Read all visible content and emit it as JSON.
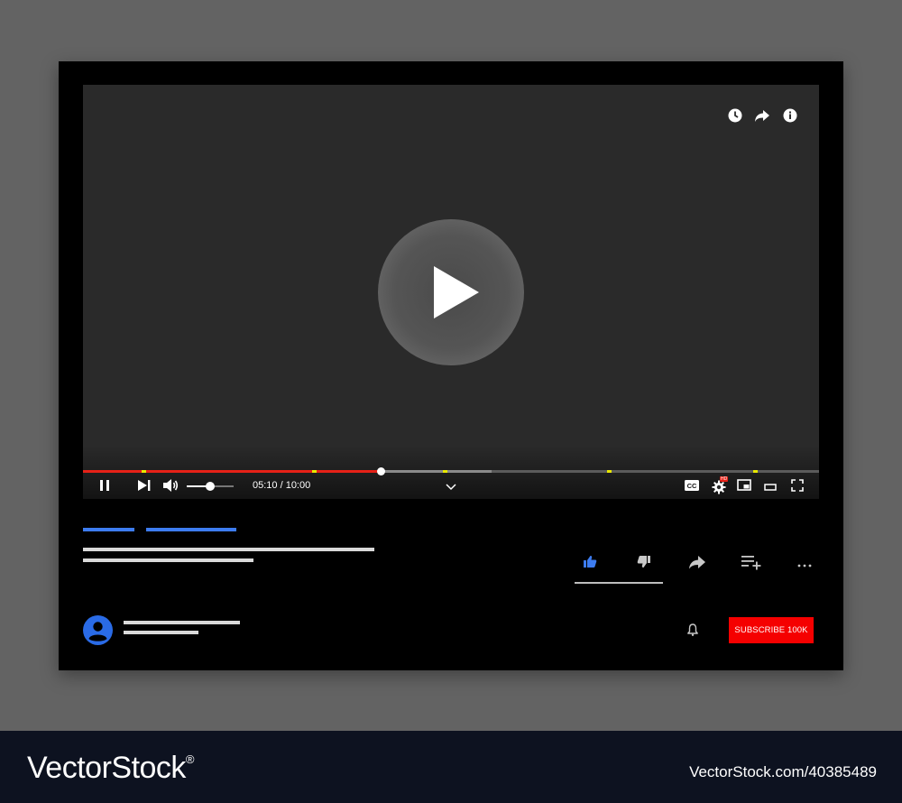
{
  "player": {
    "time_display": "05:10 / 10:00",
    "progress_played": 0.405,
    "progress_buffered": 0.555,
    "volume_level": 0.5,
    "chapter_markers": [
      0.082,
      0.314,
      0.491,
      0.714,
      0.913
    ],
    "settings_badge": "HD",
    "top_icons": [
      "watch-later-icon",
      "share-icon",
      "info-icon"
    ]
  },
  "actions": [
    "like-icon",
    "dislike-icon",
    "share-icon",
    "add-to-playlist-icon",
    "more-icon"
  ],
  "channel": {
    "subscribe_label": "SUBSCRIBE 100K"
  },
  "footer": {
    "brand": "VectorStock",
    "registered_mark": "®",
    "stock_id": "VectorStock.com/40385489"
  },
  "colors": {
    "played": "#e62117",
    "accent_blue": "#3d7cf0",
    "subscribe": "#f50000",
    "chapter_marker": "#e8e800"
  }
}
